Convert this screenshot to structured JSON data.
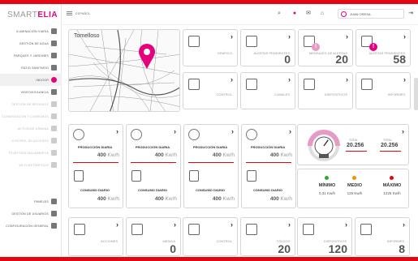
{
  "brand": {
    "logo_light": "SMART",
    "logo_bold": "ELIA"
  },
  "sidebar": {
    "items": [
      {
        "label": "Iluminación viaria",
        "icon": "lightbulb-icon",
        "state": "normal"
      },
      {
        "label": "Gestión de agua",
        "icon": "water-drop-icon",
        "state": "normal"
      },
      {
        "label": "Parques y jardines",
        "icon": "tree-icon",
        "state": "normal"
      },
      {
        "label": "Ratio sanitario",
        "icon": "wheelchair-icon",
        "state": "normal"
      },
      {
        "label": "Indoor",
        "icon": "location-pin-icon",
        "state": "active"
      },
      {
        "label": "Videovigilancia",
        "icon": "camera-icon",
        "state": "normal"
      },
      {
        "label": "Gestión de residuos",
        "icon": "truck-icon",
        "state": "dim"
      },
      {
        "label": "Climatización y consumos",
        "icon": "thermometer-icon",
        "state": "dim"
      },
      {
        "label": "Actividad urbana",
        "icon": "person-icon",
        "state": "dim"
      },
      {
        "label": "Control de accesos",
        "icon": "key-icon",
        "state": "dim"
      },
      {
        "label": "Telefonía inalámbrica",
        "icon": "antenna-icon",
        "state": "dim"
      },
      {
        "label": "Wi-fi metrópolis",
        "icon": "wifi-icon",
        "state": "dim"
      }
    ],
    "bottom": [
      {
        "label": "Paneles",
        "icon": "panel-icon"
      },
      {
        "label": "Gestión de usuarios",
        "icon": "users-icon"
      },
      {
        "label": "Configuración general",
        "icon": "gears-icon"
      }
    ]
  },
  "topbar": {
    "crumb": "ESPAÑOL",
    "user": "JUAN ORESA"
  },
  "map": {
    "title": "Tomelloso"
  },
  "row1": [
    {
      "label": "Gráfico",
      "value": ""
    },
    {
      "label": "Alertas pendientes",
      "value": "0"
    },
    {
      "label": "Mensajes de alertas",
      "value": "20"
    },
    {
      "label": "Alertas pendientes",
      "value": "58"
    }
  ],
  "row2": [
    {
      "label": "Control"
    },
    {
      "label": "Canales"
    },
    {
      "label": "Dispositivos"
    },
    {
      "label": "Informes"
    }
  ],
  "energy": [
    {
      "prod_label": "PRODUCCIÓN DIARIA",
      "prod_val": "400",
      "cons_label": "CONSUMO DIARIO",
      "cons_val": "400",
      "unit": "Kw/h"
    },
    {
      "prod_label": "PRODUCCIÓN DIARIA",
      "prod_val": "400",
      "cons_label": "CONSUMO DIARIO",
      "cons_val": "400",
      "unit": "Kw/h"
    },
    {
      "prod_label": "PRODUCCIÓN DIARIA",
      "prod_val": "400",
      "cons_label": "CONSUMO DIARIO",
      "cons_val": "400",
      "unit": "Kw/h"
    },
    {
      "prod_label": "PRODUCCIÓN DIARIA",
      "prod_val": "400",
      "cons_label": "CONSUMO DIARIO",
      "cons_val": "400",
      "unit": "Kw/h"
    }
  ],
  "gauge": {
    "total1_label": "TOTAL",
    "total1": "20.256",
    "total2_label": "TOTAL",
    "total2": "20.256",
    "level": 0.7
  },
  "stats": {
    "min_label": "MÍNIMO",
    "min_val": "0,31 Kw/h",
    "min_color": "#2ea836",
    "med_label": "MEDIO",
    "med_val": "125 Kw/h",
    "med_color": "#f39200",
    "max_label": "MÁXIMO",
    "max_val": "1225 Kw/h",
    "max_color": "#e30613"
  },
  "row4": [
    {
      "label": "Acciones",
      "value": ""
    },
    {
      "label": "Medida",
      "value": "0"
    },
    {
      "label": "Control",
      "value": ""
    },
    {
      "label": "Tóldos",
      "value": "20"
    },
    {
      "label": "Dispositivos",
      "value": "120"
    },
    {
      "label": "Informes",
      "value": "8"
    }
  ],
  "colors": {
    "accent": "#e6007e",
    "brand_red": "#e30613"
  }
}
